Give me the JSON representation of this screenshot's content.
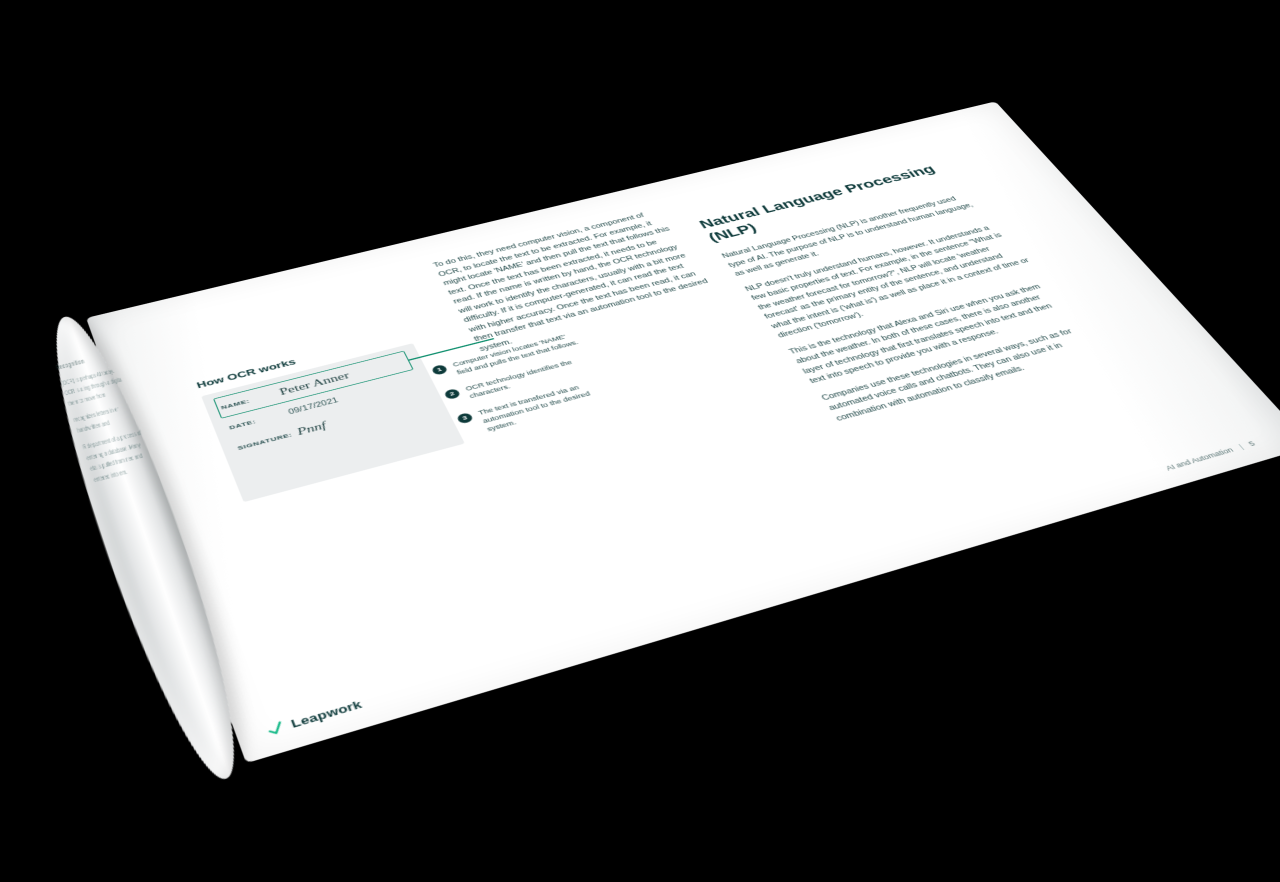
{
  "brand": {
    "name": "Leapwork"
  },
  "curl": {
    "heading": "Recognition",
    "p1": "(OCR) is perhaps AI today. OCR is a ing through a digita them to move from",
    "p2": "recognizes letters in er handwritten and",
    "p3": "R department of a process of entering a database. Many etails pulled from ned and entered into em."
  },
  "left": {
    "ocrHeading": "How OCR works",
    "form": {
      "nameLabel": "NAME:",
      "nameValue": "Peter Anner",
      "dateLabel": "DATE:",
      "dateValue": "09/17/2021",
      "sigLabel": "SIGNATURE:",
      "sigValue": "Pnnf"
    },
    "steps": [
      {
        "n": "1",
        "text": "Computer vision locates 'NAME' field and pulls the text that follows."
      },
      {
        "n": "2",
        "text": "OCR technology identifies the characters."
      },
      {
        "n": "3",
        "text": "The text is transfered via an automation tool to the desired system."
      }
    ]
  },
  "mid": {
    "p1": "To do this, they need computer vision, a component of OCR, to locate the text to be extracted. For example, it might locate 'NAME' and then pull the text that follows this text. Once the text has been extracted, it needs to be read. If the name is written by hand, the OCR technology will work to identify the characters, usually with a bit more difficulty. If it is computer-generated, it can read the text with higher accuracy. Once the text has been read, it can then transfer that text via an automation tool to the desired system."
  },
  "right": {
    "heading": "Natural Language Processing (NLP)",
    "p1": "Natural Language Processing (NLP) is another frequently used type of AI. The purpose of NLP is to understand human language, as well as generate it.",
    "p2": "NLP doesn't truly understand humans, however. It understands a few basic properties of text. For example, in the sentence \"What is the weather forecast for tomorrow?\", NLP will locate 'weather forecast' as the primary entity of the sentence, and understand what the intent is ('what is') as well as place it in a context of time or direction ('tomorrow').",
    "p3": "This is the technology that Alexa and Siri use when you ask them about the weather. In both of these cases, there is also another layer of technology that first translates speech into text and then text into speech to provide you with a response.",
    "p4": "Companies use these technologies in several ways, such as for automated voice calls and chatbots. They can also use it in combination with automation to classify emails."
  },
  "footer": {
    "title": "AI and Automation",
    "sep": "|",
    "page": "5"
  }
}
